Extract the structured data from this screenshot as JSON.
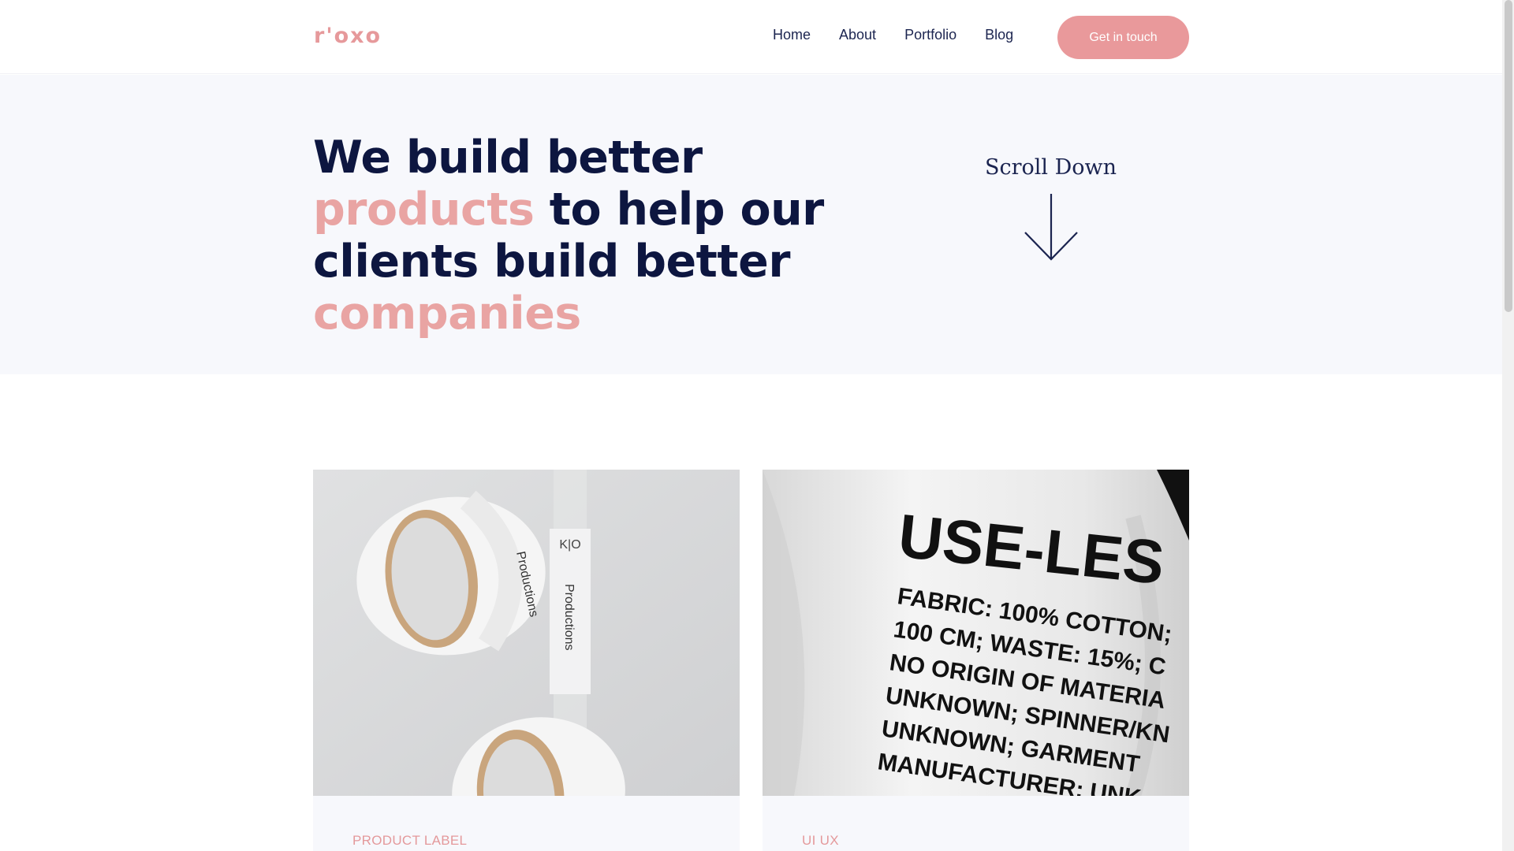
{
  "header": {
    "logo": "r'oxo",
    "nav": [
      "Home",
      "About",
      "Portfolio",
      "Blog"
    ],
    "cta_label": "Get in touch"
  },
  "hero": {
    "title_part1": "We build better ",
    "title_accent1": "products",
    "title_part2": " to help our clients build better ",
    "title_accent2": "companies",
    "scroll_label": "Scroll Down"
  },
  "portfolio": {
    "cards": [
      {
        "category": "PRODUCT LABEL",
        "image_text_a": "K|O",
        "image_text_b": "Productions"
      },
      {
        "category": "UI UX",
        "image_text_lines": [
          "USE-LES",
          "FABRIC: 100% COTTON;",
          "100 CM; WASTE: 15%; C",
          "NO ORIGIN OF MATERIA",
          "UNKNOWN; SPINNER/KN",
          "UNKNOWN; GARMENT",
          "MANUFACTURER: UNK"
        ]
      }
    ]
  },
  "colors": {
    "accent": "#e9999b",
    "heading": "#0d1640",
    "hero_bg": "#f7f8fc"
  }
}
